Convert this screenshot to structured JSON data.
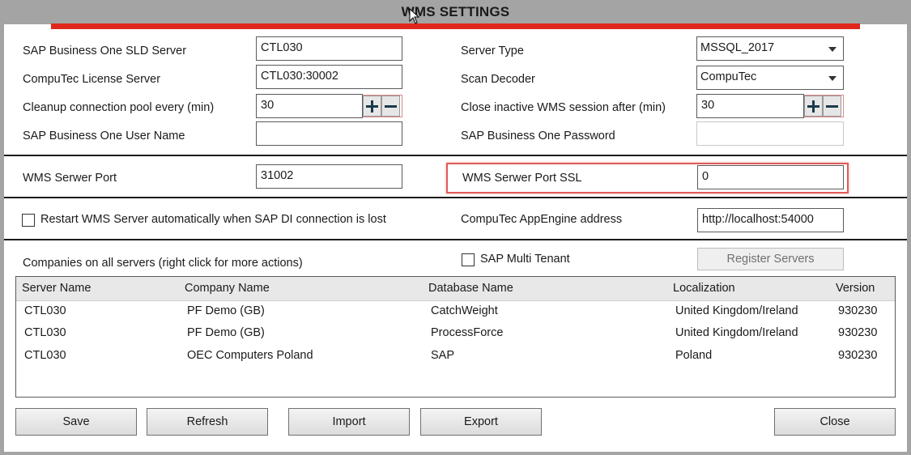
{
  "window": {
    "title": "WMS SETTINGS",
    "accent_color": "#e0271b"
  },
  "fields": {
    "sld_server": {
      "label": "SAP Business One SLD Server",
      "value": "CTL030"
    },
    "license_server": {
      "label": "CompuTec License Server",
      "value": "CTL030:30002"
    },
    "cleanup_pool": {
      "label": "Cleanup connection pool every (min)",
      "value": "30"
    },
    "user_name": {
      "label": "SAP Business One User Name",
      "value": ""
    },
    "server_type": {
      "label": "Server Type",
      "value": "MSSQL_2017"
    },
    "scan_decoder": {
      "label": "Scan Decoder",
      "value": "CompuTec"
    },
    "close_inactive": {
      "label": "Close inactive WMS session after (min)",
      "value": "30"
    },
    "password": {
      "label": "SAP Business One Password",
      "value": ""
    },
    "server_port": {
      "label": "WMS Serwer Port",
      "value": "31002"
    },
    "server_port_ssl": {
      "label": "WMS Serwer Port SSL",
      "value": "0"
    },
    "restart_auto": {
      "label": "Restart WMS Server automatically when SAP DI connection is lost",
      "checked": false
    },
    "appengine": {
      "label": "CompuTec AppEngine address",
      "value": "http://localhost:54000"
    },
    "companies_label": "Companies on all servers (right click for more actions)",
    "multi_tenant": {
      "label": "SAP Multi Tenant",
      "checked": false
    },
    "register_servers": "Register Servers"
  },
  "table": {
    "columns": [
      "Server Name",
      "Company Name",
      "Database Name",
      "Localization",
      "Version"
    ],
    "rows": [
      [
        "CTL030",
        "PF Demo (GB)",
        "CatchWeight",
        "United Kingdom/Ireland",
        "930230"
      ],
      [
        "CTL030",
        "PF Demo (GB)",
        "ProcessForce",
        "United Kingdom/Ireland",
        "930230"
      ],
      [
        "CTL030",
        "OEC Computers Poland",
        "SAP",
        "Poland",
        "930230"
      ]
    ]
  },
  "buttons": {
    "save": "Save",
    "refresh": "Refresh",
    "import": "Import",
    "export": "Export",
    "close": "Close"
  }
}
